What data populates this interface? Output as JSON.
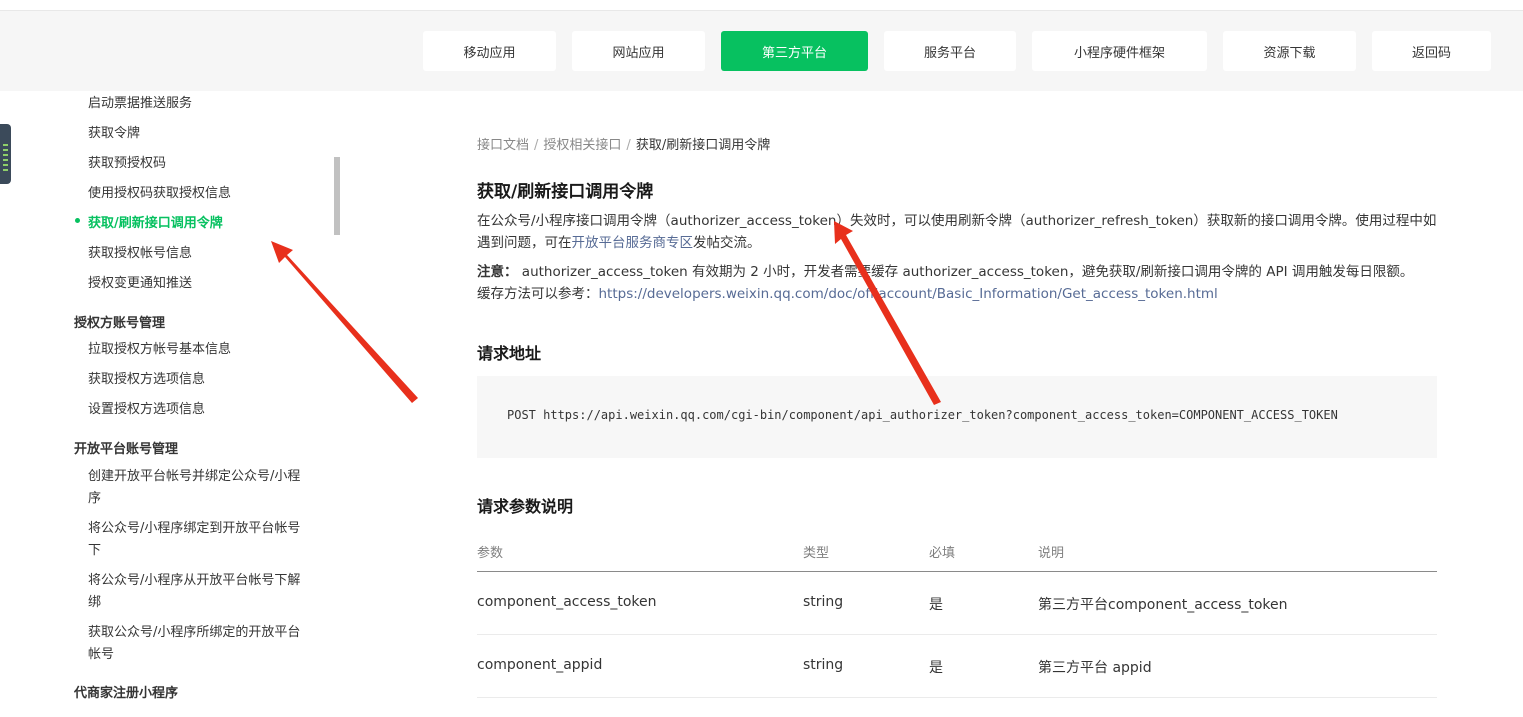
{
  "nav": {
    "items": [
      {
        "label": "移动应用"
      },
      {
        "label": "网站应用"
      },
      {
        "label": "第三方平台"
      },
      {
        "label": "服务平台"
      },
      {
        "label": "小程序硬件框架"
      },
      {
        "label": "资源下载"
      },
      {
        "label": "返回码"
      }
    ],
    "active_index": 2
  },
  "sidebar": {
    "items_a": [
      "启动票据推送服务",
      "获取令牌",
      "获取预授权码",
      "使用授权码获取授权信息",
      "获取/刷新接口调用令牌",
      "获取授权帐号信息",
      "授权变更通知推送"
    ],
    "group1": "授权方账号管理",
    "items_b": [
      "拉取授权方帐号基本信息",
      "获取授权方选项信息",
      "设置授权方选项信息"
    ],
    "group2": "开放平台账号管理",
    "items_c": [
      "创建开放平台帐号并绑定公众号/小程序",
      "将公众号/小程序绑定到开放平台帐号下",
      "将公众号/小程序从开放平台帐号下解绑",
      "获取公众号/小程序所绑定的开放平台帐号"
    ],
    "group3": "代商家注册小程序"
  },
  "breadcrumb": {
    "item1": "接口文档",
    "item2": "授权相关接口",
    "sep": "/",
    "current": "获取/刷新接口调用令牌"
  },
  "doc": {
    "title": "获取/刷新接口调用令牌",
    "intro_part1": "在公众号/小程序接口调用令牌（authorizer_access_token）失效时，可以使用刷新令牌（authorizer_refresh_token）获取新的接口调用令牌。使用过程中如遇到问题，可在",
    "intro_link": "开放平台服务商专区",
    "intro_part2": "发帖交流。",
    "note_label": "注意：",
    "note_text": " authorizer_access_token 有效期为 2 小时，开发者需要缓存 authorizer_access_token，避免获取/刷新接口调用令牌的 API 调用触发每日限额。",
    "cache_text": "缓存方法可以参考：",
    "cache_link": "https://developers.weixin.qq.com/doc/offiaccount/Basic_Information/Get_access_token.html",
    "section_url": "请求地址",
    "request_url": "POST https://api.weixin.qq.com/cgi-bin/component/api_authorizer_token?component_access_token=COMPONENT_ACCESS_TOKEN",
    "section_params": "请求参数说明"
  },
  "params_table": {
    "headers": [
      "参数",
      "类型",
      "必填",
      "说明"
    ],
    "rows": [
      [
        "component_access_token",
        "string",
        "是",
        "第三方平台component_access_token"
      ],
      [
        "component_appid",
        "string",
        "是",
        "第三方平台 appid"
      ]
    ]
  },
  "colors": {
    "accent": "#07c160",
    "link": "#576b95",
    "annotation_arrow": "#e8301c"
  }
}
